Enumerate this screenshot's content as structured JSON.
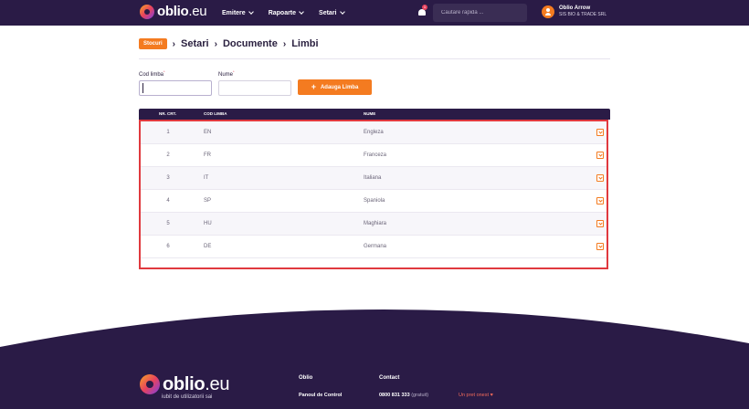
{
  "colors": {
    "navbar": "#2a1b46",
    "accent": "#f47b20",
    "highlight_border": "#e0393e",
    "footer": "#2a1b46"
  },
  "brand": {
    "name": "oblio",
    "tld": ".eu"
  },
  "nav": {
    "items": [
      {
        "label": "Emitere"
      },
      {
        "label": "Rapoarte"
      },
      {
        "label": "Setari"
      }
    ],
    "notifications_count": "1",
    "search_placeholder": "Cautare rapida ..."
  },
  "user": {
    "name": "Oblio Arrow",
    "company": "SIS BIO & TRADE SRL"
  },
  "breadcrumb": {
    "badge": "Stocuri",
    "items": [
      "Setari",
      "Documente",
      "Limbi"
    ]
  },
  "form": {
    "code_label": "Cod limba",
    "code_value": "",
    "name_label": "Nume",
    "name_value": "",
    "required_mark": "*",
    "add_button": "Adauga Limba"
  },
  "table": {
    "headers": [
      "NR. CRT.",
      "COD LIMBA",
      "NUME"
    ],
    "rows": [
      {
        "nr": "1",
        "cod": "EN",
        "nume": "Engleza"
      },
      {
        "nr": "2",
        "cod": "FR",
        "nume": "Franceza"
      },
      {
        "nr": "3",
        "cod": "IT",
        "nume": "Italiana"
      },
      {
        "nr": "4",
        "cod": "SP",
        "nume": "Spaniola"
      },
      {
        "nr": "5",
        "cod": "HU",
        "nume": "Maghiara"
      },
      {
        "nr": "6",
        "cod": "DE",
        "nume": "Germana"
      }
    ]
  },
  "footer": {
    "tagline": "iubit de utilizatorii sai",
    "col1_title": "Oblio",
    "col1_link": "Panoul de Control",
    "col2_title": "Contact",
    "phone": "0800 831 333",
    "phone_note": "(gratuit)",
    "price_note": "Un pret onest",
    "heart": "♥"
  }
}
